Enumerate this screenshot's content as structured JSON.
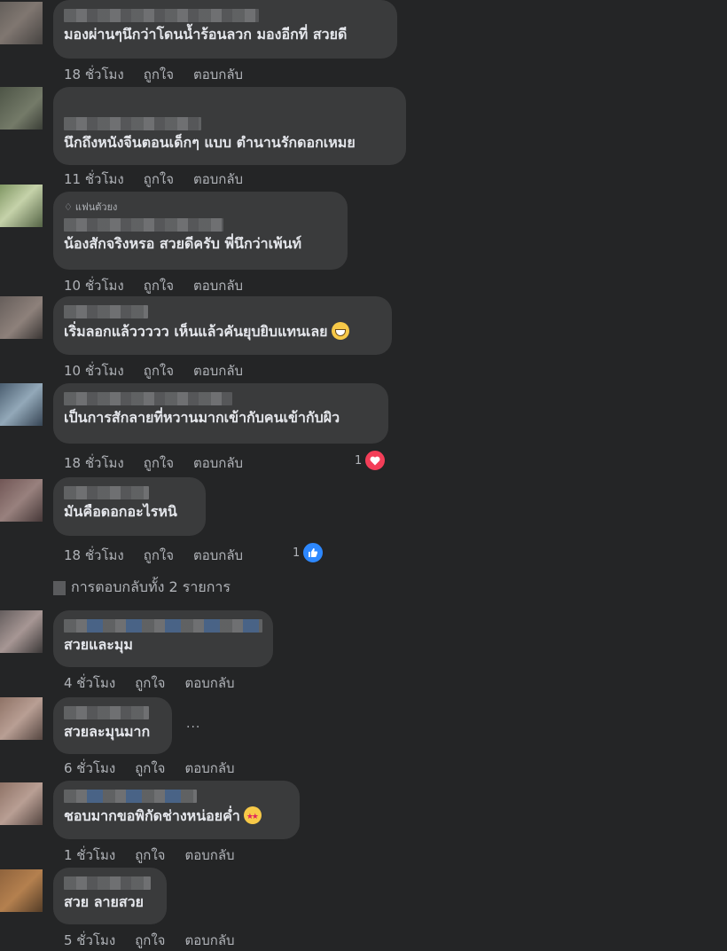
{
  "comments": [
    {
      "text": "มองผ่านๆนึกว่าโดนน้ำร้อนลวก มองอีกที่ สวยดี",
      "time": "18 ชั่วโมง",
      "like": "ถูกใจ",
      "reply": "ตอบกลับ"
    },
    {
      "text": "นึกถึงหนังจีนตอนเด็กๆ แบบ ตำนานรักดอกเหมย",
      "time": "11 ชั่วโมง",
      "like": "ถูกใจ",
      "reply": "ตอบกลับ"
    },
    {
      "badge": "แฟนตัวยง",
      "text": "น้องสักจริงหรอ สวยดีครับ พี่นึกว่าเพ้นท์",
      "time": "10 ชั่วโมง",
      "like": "ถูกใจ",
      "reply": "ตอบกลับ"
    },
    {
      "text": "เริ่มลอกแล้ววววว เห็นแล้วคันยุบยิบแทนเลย",
      "emoji": "grin-emoji",
      "time": "10 ชั่วโมง",
      "like": "ถูกใจ",
      "reply": "ตอบกลับ"
    },
    {
      "text": "เป็นการสักลายที่หวานมากเข้ากับคนเข้ากับผิว",
      "time": "18 ชั่วโมง",
      "like": "ถูกใจ",
      "reply": "ตอบกลับ",
      "reaction_count": "1",
      "reaction": "heart"
    },
    {
      "text": "มันคือดอกอะไรหนิ",
      "time": "18 ชั่วโมง",
      "like": "ถูกใจ",
      "reply": "ตอบกลับ",
      "reaction_count": "1",
      "reaction": "like"
    },
    {
      "text": "สวยและมุม",
      "time": "4 ชั่วโมง",
      "like": "ถูกใจ",
      "reply": "ตอบกลับ"
    },
    {
      "text": "สวยละมุนมาก",
      "time": "6 ชั่วโมง",
      "like": "ถูกใจ",
      "reply": "ตอบกลับ"
    },
    {
      "text": "ชอบมากขอพิกัดช่างหน่อยค่ำ",
      "emoji": "star-eyes-emoji",
      "time": "1 ชั่วโมง",
      "like": "ถูกใจ",
      "reply": "ตอบกลับ"
    },
    {
      "text": "สวย ลายสวย",
      "time": "5 ชั่วโมง",
      "like": "ถูกใจ",
      "reply": "ตอบกลับ"
    }
  ],
  "view_replies": "การตอบกลับทั้ง 2 รายการ",
  "more_options": "...",
  "colors": {
    "background": "#242526",
    "bubble": "#3a3b3c",
    "text": "#e4e6eb",
    "meta": "#b0b3b8",
    "heart": "#f33e58",
    "like": "#2d88ff"
  }
}
